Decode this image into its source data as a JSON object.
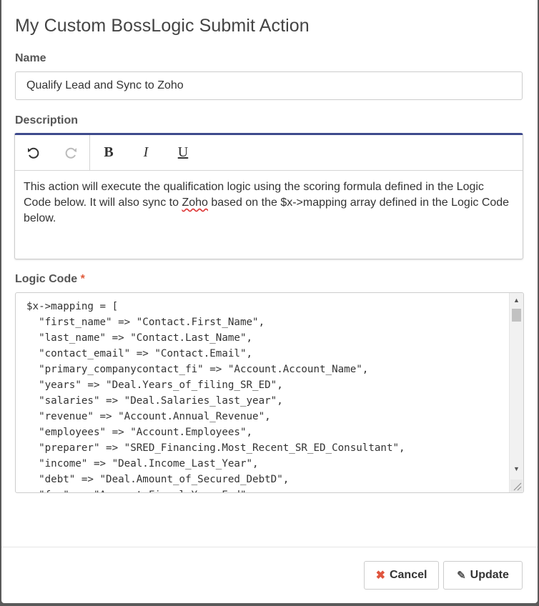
{
  "dialog": {
    "title": "My Custom BossLogic Submit Action"
  },
  "name_field": {
    "label": "Name",
    "value": "Qualify Lead and Sync to Zoho"
  },
  "description_field": {
    "label": "Description",
    "toolbar": {
      "undo_icon": "undo-icon",
      "redo_icon": "redo-icon",
      "bold_label": "B",
      "italic_label": "I",
      "underline_label": "U"
    },
    "content": {
      "part1": "This action will execute the qualification logic using the scoring formula defined in the Logic Code below. It will also sync to ",
      "misspelled": "Zoho",
      "part2": " based on the $x->mapping array defined in the Logic Code below."
    }
  },
  "logic_code_field": {
    "label": "Logic Code",
    "required_marker": "*",
    "code": "$x->mapping = [\n  \"first_name\" => \"Contact.First_Name\",\n  \"last_name\" => \"Contact.Last_Name\",\n  \"contact_email\" => \"Contact.Email\",\n  \"primary_companycontact_fi\" => \"Account.Account_Name\",\n  \"years\" => \"Deal.Years_of_filing_SR_ED\",\n  \"salaries\" => \"Deal.Salaries_last_year\",\n  \"revenue\" => \"Account.Annual_Revenue\",\n  \"employees\" => \"Account.Employees\",\n  \"preparer\" => \"SRED_Financing.Most_Recent_SR_ED_Consultant\",\n  \"income\" => \"Deal.Income_Last_Year\",\n  \"debt\" => \"Deal.Amount_of_Secured_DebtD\",\n  \"fye\" => \"Account.Fiscal_Year_End\","
  },
  "footer": {
    "cancel_label": "Cancel",
    "update_label": "Update"
  },
  "colors": {
    "editor_accent": "#3e4a8c",
    "required": "#e05a3a",
    "cancel_icon": "#e0553e"
  }
}
